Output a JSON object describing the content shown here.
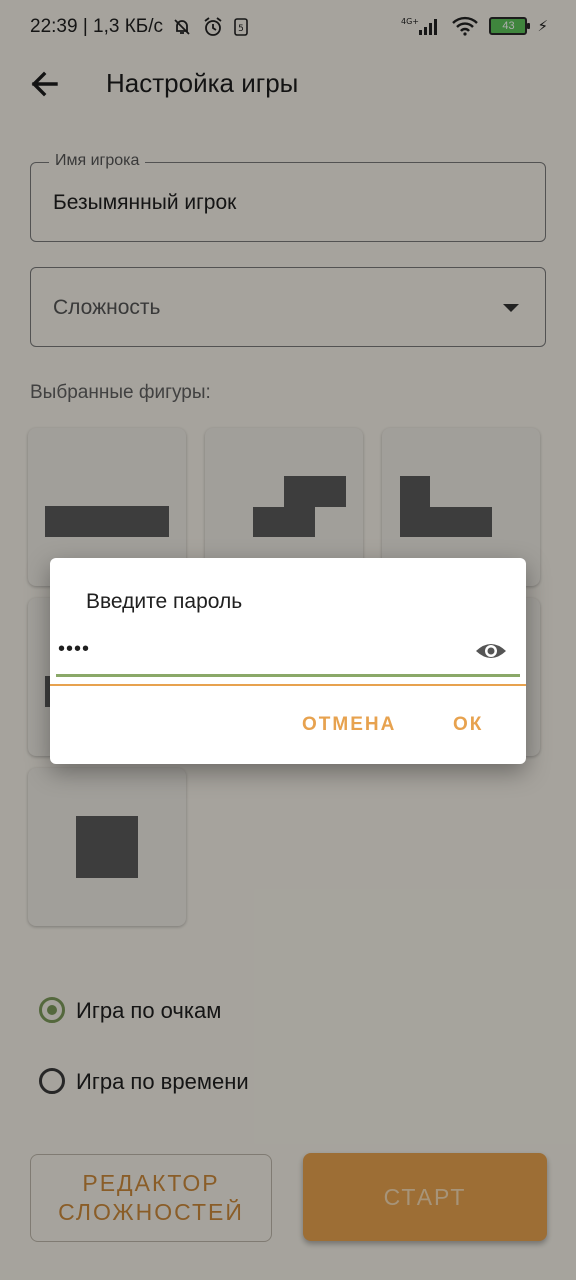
{
  "status_bar": {
    "time_speed": "22:39 | 1,3 КБ/с",
    "battery": "43",
    "network": "4G+"
  },
  "app_bar": {
    "title": "Настройка игры",
    "back_icon": "arrow-back-icon"
  },
  "player_field": {
    "label": "Имя игрока",
    "value": "Безымянный игрок"
  },
  "difficulty_field": {
    "placeholder": "Сложность",
    "icon": "dropdown-arrow-icon"
  },
  "figures": {
    "label": "Выбранные фигуры:"
  },
  "modes": [
    {
      "label": "Игра по очкам",
      "selected": true
    },
    {
      "label": "Игра по времени",
      "selected": false
    }
  ],
  "buttons": {
    "editor_line1": "РЕДАКТОР",
    "editor_line2": "СЛОЖНОСТЕЙ",
    "start": "СТАРТ"
  },
  "dialog": {
    "title": "Введите пароль",
    "password_value": "••••",
    "eye_icon": "visibility-icon",
    "cancel": "ОТМЕНА",
    "ok": "ОК"
  },
  "colors": {
    "accent": "#e7a24f",
    "radio": "#7d9a5a",
    "figure": "#5a5a5a"
  }
}
